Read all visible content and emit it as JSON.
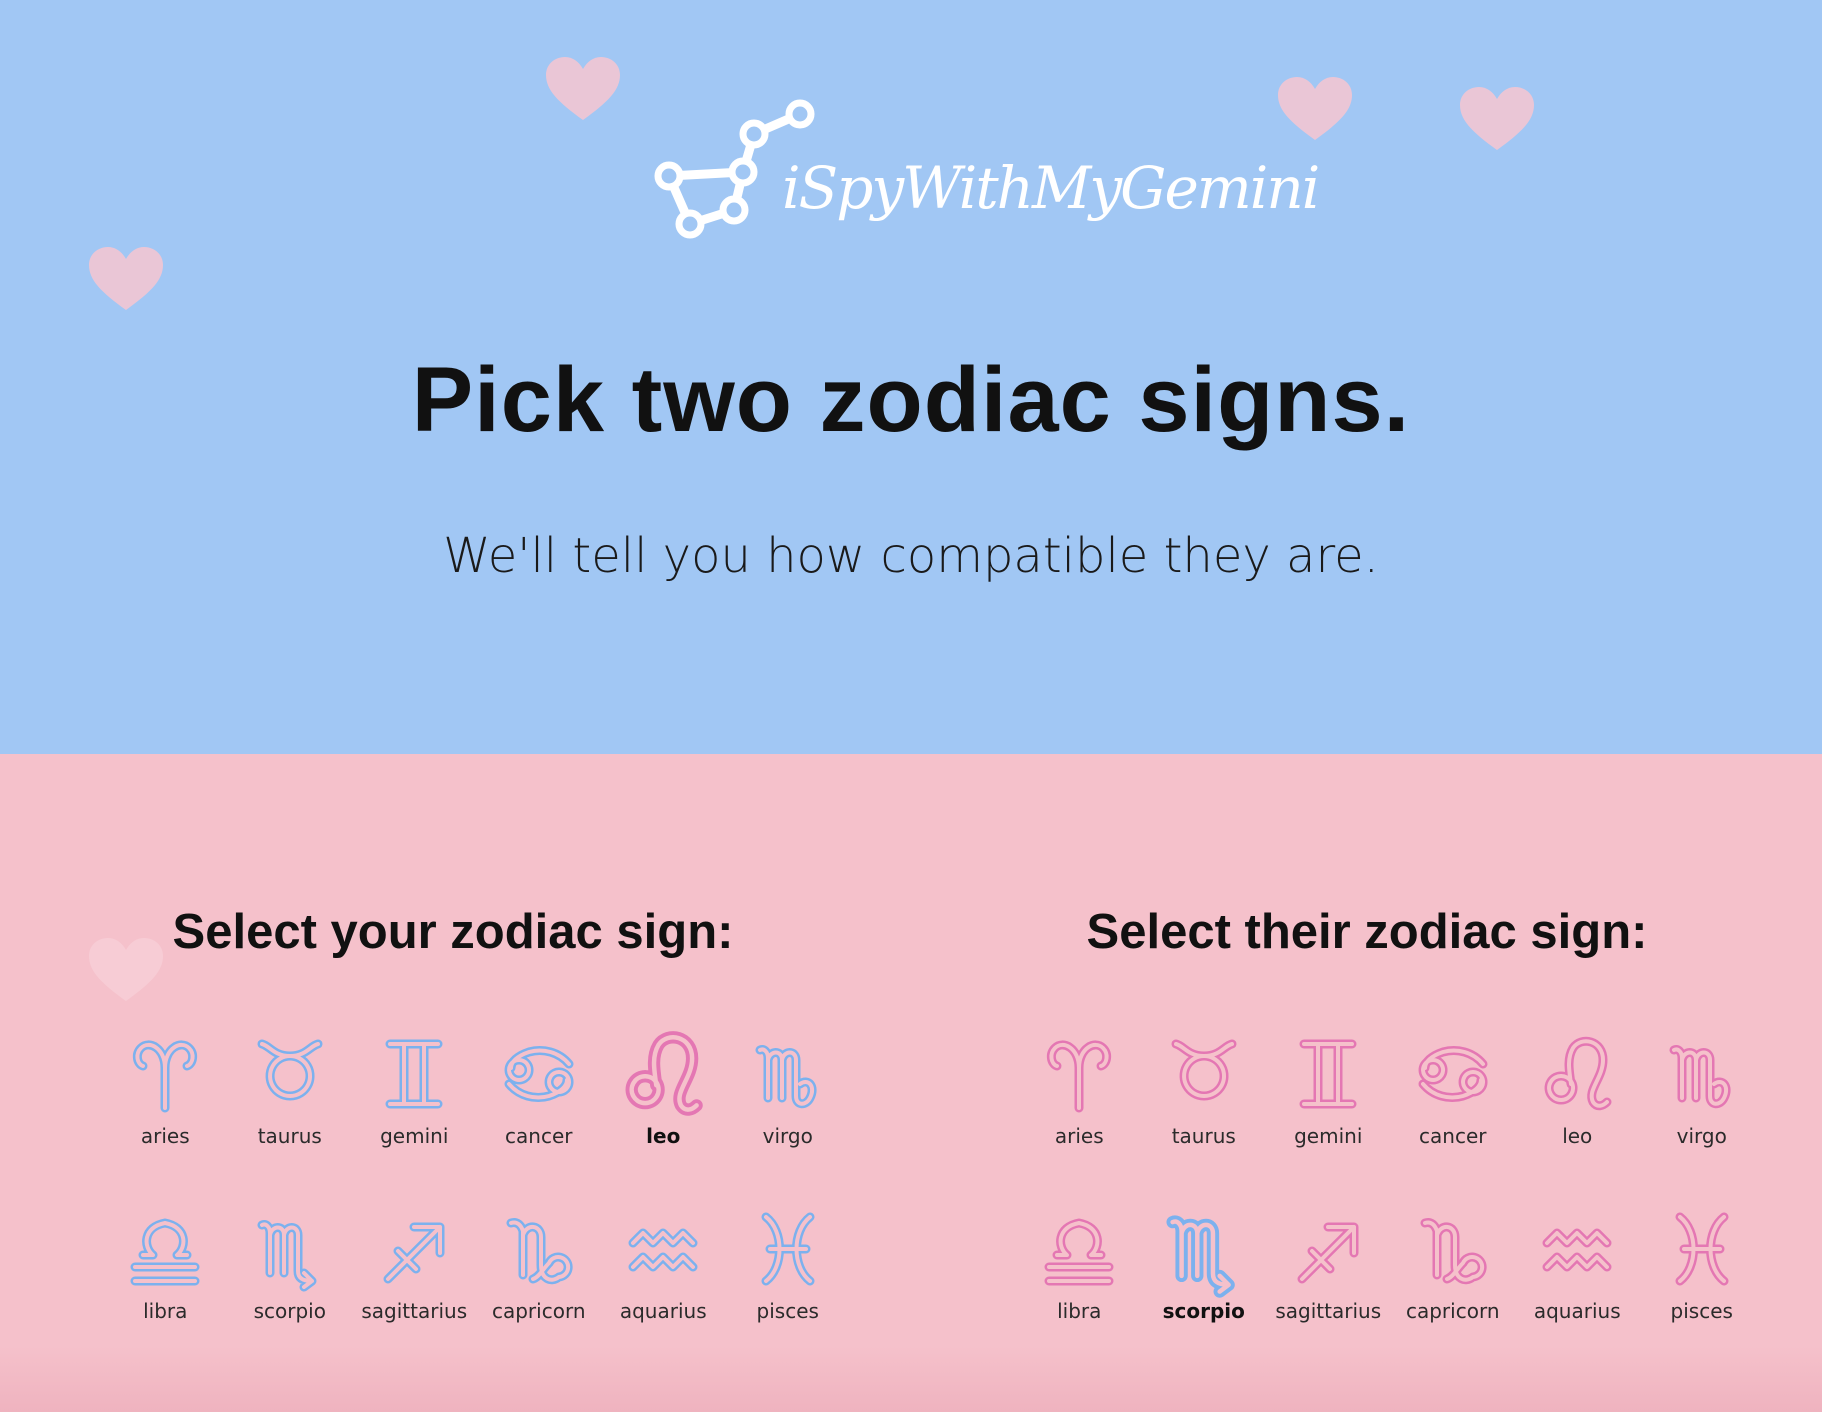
{
  "brand": {
    "name": "iSpyWithMyGemini",
    "icon": "constellation-logo-icon",
    "color": "#ffffff"
  },
  "hero": {
    "title": "Pick two zodiac signs.",
    "subtitle": "We'll tell you how compatible they are.",
    "background": "#a1c7f4",
    "decoration": "heart-icon"
  },
  "picker_background": "#f5c1cb",
  "colors": {
    "blue": "#7cb1ee",
    "pink": "#e477b3"
  },
  "your_sign": {
    "title": "Select your zodiac sign:",
    "selected": "leo",
    "signs": [
      {
        "key": "aries",
        "label": "aries",
        "color": "blue"
      },
      {
        "key": "taurus",
        "label": "taurus",
        "color": "blue"
      },
      {
        "key": "gemini",
        "label": "gemini",
        "color": "blue"
      },
      {
        "key": "cancer",
        "label": "cancer",
        "color": "blue"
      },
      {
        "key": "leo",
        "label": "leo",
        "color": "pink"
      },
      {
        "key": "virgo",
        "label": "virgo",
        "color": "blue"
      },
      {
        "key": "libra",
        "label": "libra",
        "color": "blue"
      },
      {
        "key": "scorpio",
        "label": "scorpio",
        "color": "blue"
      },
      {
        "key": "sagittarius",
        "label": "sagittarius",
        "color": "blue"
      },
      {
        "key": "capricorn",
        "label": "capricorn",
        "color": "blue"
      },
      {
        "key": "aquarius",
        "label": "aquarius",
        "color": "blue"
      },
      {
        "key": "pisces",
        "label": "pisces",
        "color": "blue"
      }
    ]
  },
  "their_sign": {
    "title": "Select their zodiac sign:",
    "selected": "scorpio",
    "signs": [
      {
        "key": "aries",
        "label": "aries",
        "color": "pink"
      },
      {
        "key": "taurus",
        "label": "taurus",
        "color": "pink"
      },
      {
        "key": "gemini",
        "label": "gemini",
        "color": "pink"
      },
      {
        "key": "cancer",
        "label": "cancer",
        "color": "pink"
      },
      {
        "key": "leo",
        "label": "leo",
        "color": "pink"
      },
      {
        "key": "virgo",
        "label": "virgo",
        "color": "pink"
      },
      {
        "key": "libra",
        "label": "libra",
        "color": "pink"
      },
      {
        "key": "scorpio",
        "label": "scorpio",
        "color": "blue"
      },
      {
        "key": "sagittarius",
        "label": "sagittarius",
        "color": "pink"
      },
      {
        "key": "capricorn",
        "label": "capricorn",
        "color": "pink"
      },
      {
        "key": "aquarius",
        "label": "aquarius",
        "color": "pink"
      },
      {
        "key": "pisces",
        "label": "pisces",
        "color": "pink"
      }
    ]
  }
}
